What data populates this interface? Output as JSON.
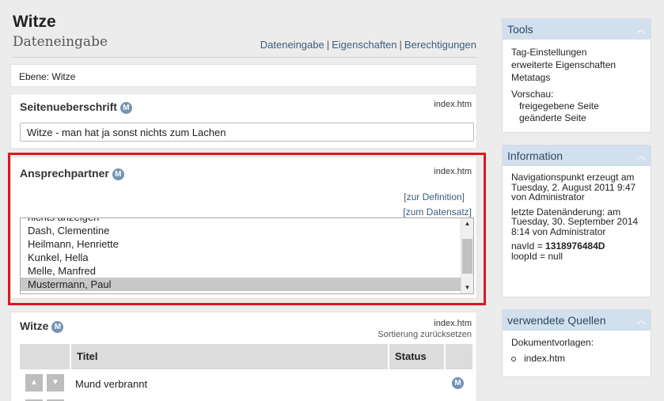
{
  "header": {
    "title": "Witze",
    "subtitle": "Dateneingabe",
    "nav": [
      "Dateneingabe",
      "Eigenschaften",
      "Berechtigungen"
    ],
    "separator": "|"
  },
  "ebene": {
    "text": "Ebene: Witze"
  },
  "seitenueberschrift": {
    "label": "Seitenueberschrift",
    "badge": "M",
    "file": "index.htm",
    "value": "Witze - man hat ja sonst nichts zum Lachen"
  },
  "ansprechpartner": {
    "label": "Ansprechpartner",
    "badge": "M",
    "file": "index.htm",
    "link_definition": "[zur Definition]",
    "link_datensatz": "[zum Datensatz]",
    "items": [
      {
        "label": "nichts anzeigen"
      },
      {
        "label": "Dash, Clementine"
      },
      {
        "label": "Heilmann, Henriette"
      },
      {
        "label": "Kunkel, Hella"
      },
      {
        "label": "Melle, Manfred"
      },
      {
        "label": "Mustermann, Paul"
      }
    ],
    "selected": "Mustermann, Paul"
  },
  "witze": {
    "label": "Witze",
    "badge": "M",
    "file": "index.htm",
    "sort_link": "Sortierung zurücksetzen",
    "columns": [
      "",
      "Titel",
      "Status",
      ""
    ],
    "rows": [
      {
        "title": "Mund verbrannt",
        "badge": "M"
      }
    ]
  },
  "sidebar": {
    "tools": {
      "title": "Tools",
      "items": [
        "Tag-Einstellungen",
        "erweiterte Eigenschaften",
        "Metatags"
      ],
      "preview_label": "Vorschau:",
      "preview_items": [
        "freigegebene Seite",
        "geänderte Seite"
      ]
    },
    "information": {
      "title": "Information",
      "created": "Navigationspunkt erzeugt am Tuesday, 2. August 2011 9:47 von Administrator",
      "changed": "letzte Datenänderung: am Tuesday, 30. September 2014 8:14 von Administrator",
      "navid_label": "navId = ",
      "navid_value": "1318976484D",
      "loopid": "loopId = null"
    },
    "quellen": {
      "title": "verwendete Quellen",
      "label": "Dokumentvorlagen:",
      "items": [
        "index.htm"
      ]
    }
  },
  "icons": {
    "collapse": "chevron-up-icon",
    "move_up": "triangle-up-icon",
    "move_down": "triangle-down-icon"
  },
  "colors": {
    "highlight": "#e0161b",
    "link": "#3a5e7e",
    "badge": "#7393b3",
    "sidebar_header": "#d2dfed"
  }
}
